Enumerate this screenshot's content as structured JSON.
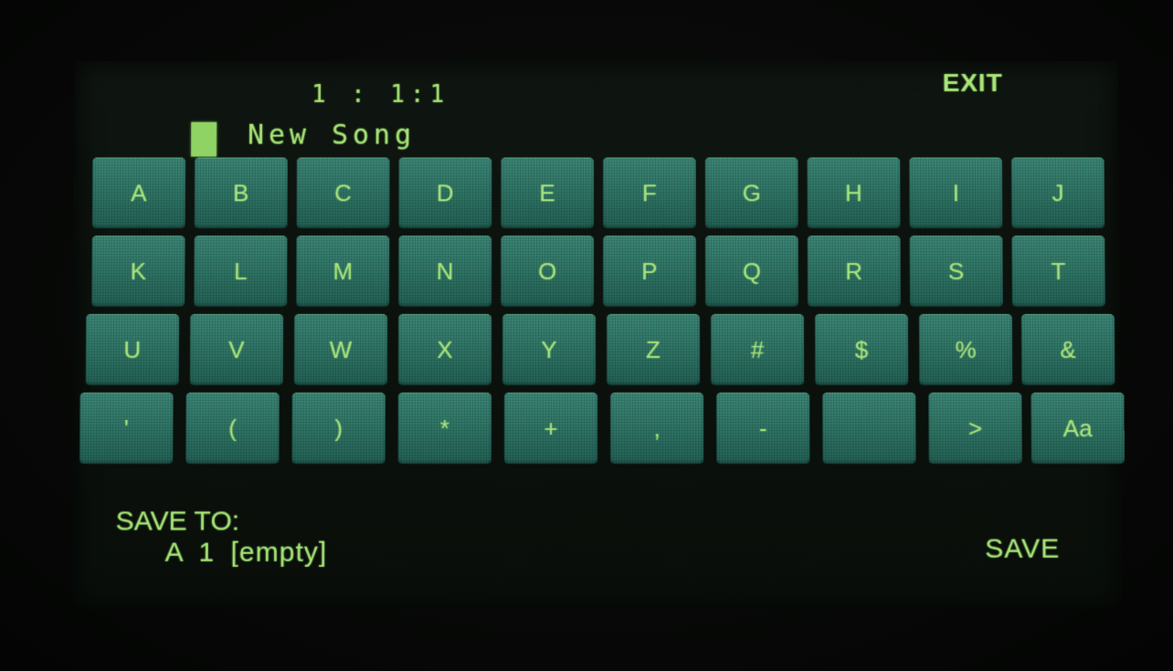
{
  "header": {
    "position": "1 : 1:1",
    "exit_label": "EXIT"
  },
  "name_field": {
    "value": "New Song"
  },
  "keyboard": {
    "rows": [
      [
        "A",
        "B",
        "C",
        "D",
        "E",
        "F",
        "G",
        "H",
        "I",
        "J"
      ],
      [
        "K",
        "L",
        "M",
        "N",
        "O",
        "P",
        "Q",
        "R",
        "S",
        "T"
      ],
      [
        "U",
        "V",
        "W",
        "X",
        "Y",
        "Z",
        "#",
        "$",
        "%",
        "&"
      ],
      [
        "'",
        "(",
        ")",
        "*",
        "+",
        ",",
        "-",
        " ",
        ">",
        "Aa"
      ]
    ]
  },
  "footer": {
    "save_to_label": "SAVE TO:",
    "save_to_slot": "A 1 [empty]",
    "save_label": "SAVE"
  },
  "colors": {
    "text": "#a7e676",
    "key_face": "#2f7767",
    "background": "#0b110c"
  }
}
